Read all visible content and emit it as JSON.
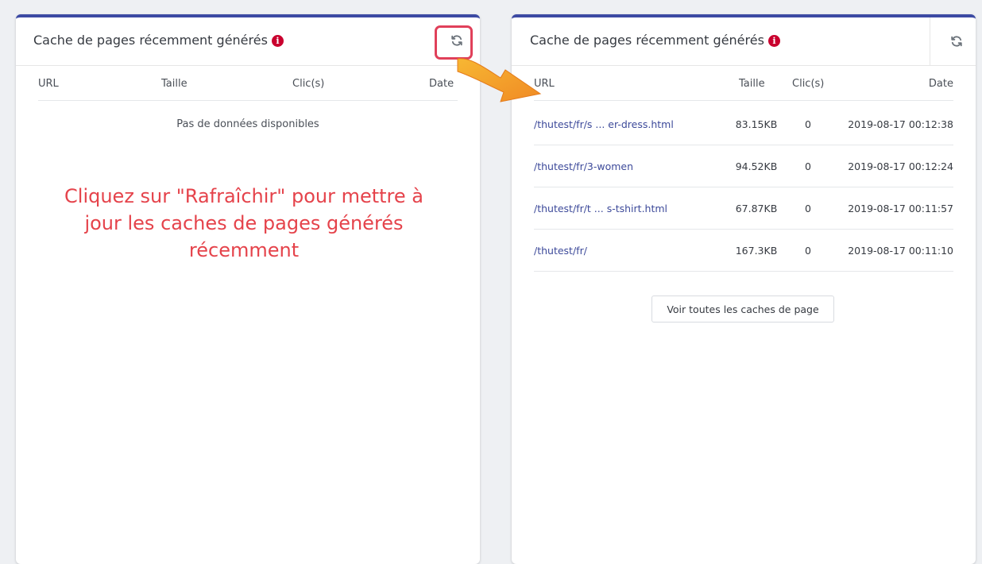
{
  "left_panel": {
    "title": "Cache de pages récemment générés",
    "columns": [
      "URL",
      "Taille",
      "Clic(s)",
      "Date"
    ],
    "empty_text": "Pas de données disponibles",
    "annotation": "Cliquez sur \"Rafraîchir\" pour mettre à jour les caches de pages générés récemment"
  },
  "right_panel": {
    "title": "Cache de pages récemment générés",
    "columns": [
      "URL",
      "Taille",
      "Clic(s)",
      "Date"
    ],
    "rows": [
      {
        "url": "/thutest/fr/s ... er-dress.html",
        "size": "83.15KB",
        "clicks": "0",
        "date": "2019-08-17 00:12:38"
      },
      {
        "url": "/thutest/fr/3-women",
        "size": "94.52KB",
        "clicks": "0",
        "date": "2019-08-17 00:12:24"
      },
      {
        "url": "/thutest/fr/t ... s-tshirt.html",
        "size": "67.87KB",
        "clicks": "0",
        "date": "2019-08-17 00:11:57"
      },
      {
        "url": "/thutest/fr/",
        "size": "167.3KB",
        "clicks": "0",
        "date": "2019-08-17 00:11:10"
      }
    ],
    "view_all_label": "Voir toutes les caches de page"
  },
  "icons": {
    "info": "info-icon",
    "refresh": "refresh-icon",
    "arrow": "arrow-annotation"
  },
  "colors": {
    "accent": "#3c4aa3",
    "link": "#3d4a9a",
    "annotation_text": "#e5434b",
    "highlight_border": "#e0405a",
    "info_icon": "#c9002e",
    "arrow": "#f5a623"
  }
}
